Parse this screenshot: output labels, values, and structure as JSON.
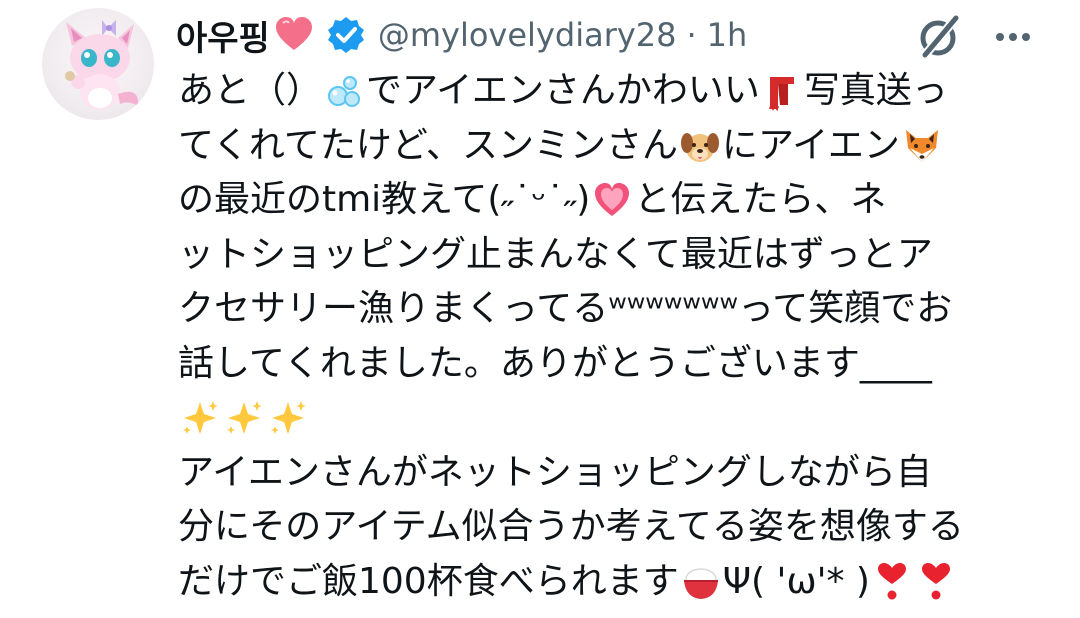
{
  "author": {
    "display_name": "아우핑",
    "handle": "@mylovelydiary28",
    "separator": "·",
    "time": "1h"
  },
  "icons": {
    "name_emoji": "red-heart-icon",
    "verified": "verified-badge-icon",
    "grok": "grok-icon",
    "more": "more-horizontal-icon"
  },
  "colors": {
    "verified": "#1d9bf0",
    "secondary_text": "#536471",
    "primary_text": "#0f1419",
    "heart": "#f4708a"
  },
  "tweet": {
    "lines": [
      {
        "a": "あと（）",
        "b": "でアイエンさんかわいい",
        "c": "写真送っ"
      },
      {
        "a": "てくれてたけど、スンミンさん",
        "b": "にアイエン"
      },
      {
        "a": "の最近のtmi教えて(˶˙ᵕ˙˶)",
        "b": "と伝えたら、ネ"
      },
      {
        "a": "ットショッピング止まんなくて最近はずっとア"
      },
      {
        "a": "クセサリー漁りまくってるʷʷʷʷʷʷʷって笑顔でお"
      },
      {
        "a": "話してくれました。ありがとうございます____"
      },
      {
        "a": ""
      },
      {
        "a": "アイエンさんがネットショッピングしながら自"
      },
      {
        "a": "分にそのアイテム似合うか考えてる姿を想像する"
      },
      {
        "a": "だけでご飯100杯食べられます",
        "b": "Ψ( 'ω'* )"
      }
    ]
  }
}
